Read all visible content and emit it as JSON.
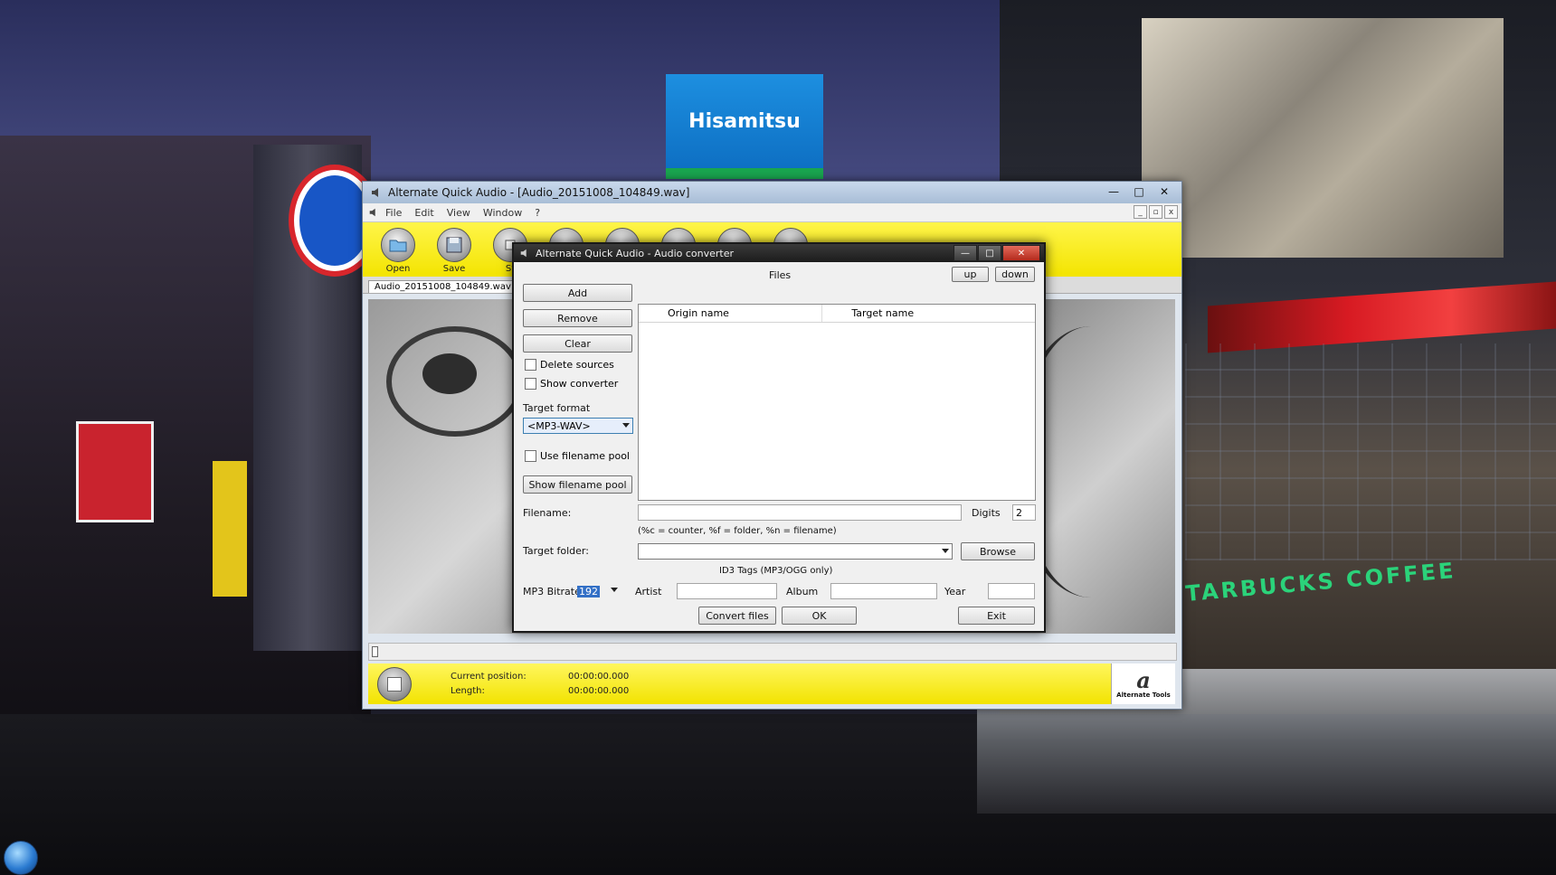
{
  "main_window": {
    "title": "Alternate Quick Audio - [Audio_20151008_104849.wav]",
    "menu": [
      "File",
      "Edit",
      "View",
      "Window",
      "?"
    ],
    "toolbar": [
      {
        "label": "Open",
        "icon": "folder-icon"
      },
      {
        "label": "Save",
        "icon": "floppy-disk-icon"
      },
      {
        "label": "St",
        "icon": "stop-icon"
      }
    ],
    "tab_label": "Audio_20151008_104849.wav",
    "status": {
      "current_position_label": "Current position:",
      "current_position_value": "00:00:00.000",
      "length_label": "Length:",
      "length_value": "00:00:00.000"
    },
    "logo": {
      "mark": "a",
      "text": "Alternate Tools"
    }
  },
  "converter": {
    "title": "Alternate Quick Audio - Audio converter",
    "files_label": "Files",
    "up_button": "up",
    "down_button": "down",
    "add_button": "Add",
    "remove_button": "Remove",
    "clear_button": "Clear",
    "delete_sources": "Delete sources",
    "show_converter": "Show converter",
    "target_format_label": "Target format",
    "target_format_value": "<MP3-WAV>",
    "use_filename_pool": "Use filename pool",
    "show_filename_pool_button": "Show filename pool",
    "columns": [
      "Origin name",
      "Target name"
    ],
    "filename_label": "Filename:",
    "filename_value": "",
    "digits_label": "Digits",
    "digits_value": "2",
    "filename_hint": "(%c = counter, %f = folder, %n = filename)",
    "target_folder_label": "Target folder:",
    "target_folder_value": "",
    "browse_button": "Browse",
    "id3_label": "ID3 Tags (MP3/OGG only)",
    "mp3_bitrate_label": "MP3 Bitrate",
    "mp3_bitrate_value": "192",
    "artist_label": "Artist",
    "album_label": "Album",
    "year_label": "Year",
    "convert_button": "Convert files",
    "ok_button": "OK",
    "exit_button": "Exit"
  },
  "desktop": {
    "sign_text": "Hisamitsu",
    "store_text": "TARBUCKS COFFEE"
  },
  "colors": {
    "toolbar_yellow": "#f3e400",
    "dialog_bg": "#f0f0f0",
    "close_red": "#c8382a"
  }
}
